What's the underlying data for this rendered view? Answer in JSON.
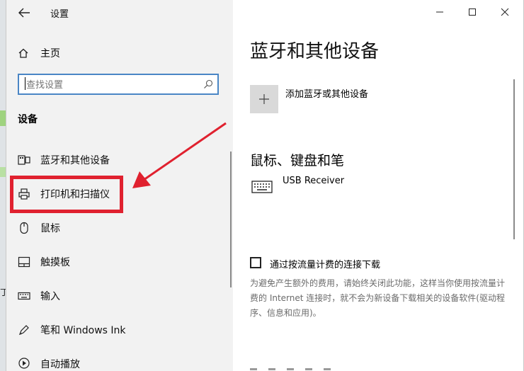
{
  "window": {
    "title": "设置"
  },
  "sidebar": {
    "home_label": "主页",
    "search_placeholder": "查找设置",
    "section_title": "设备",
    "items": [
      {
        "label": "蓝牙和其他设备",
        "icon": "bluetooth-devices-icon"
      },
      {
        "label": "打印机和扫描仪",
        "icon": "printer-icon"
      },
      {
        "label": "鼠标",
        "icon": "mouse-icon"
      },
      {
        "label": "触摸板",
        "icon": "touchpad-icon"
      },
      {
        "label": "输入",
        "icon": "keyboard-icon"
      },
      {
        "label": "笔和 Windows Ink",
        "icon": "pen-icon"
      },
      {
        "label": "自动播放",
        "icon": "autoplay-icon"
      }
    ]
  },
  "content": {
    "page_title": "蓝牙和其他设备",
    "add_device_label": "添加蓝牙或其他设备",
    "section_title": "鼠标、键盘和笔",
    "devices": [
      {
        "name": "USB Receiver",
        "icon": "keyboard-icon"
      }
    ],
    "metered_label": "通过按流量计费的连接下载",
    "metered_desc": "为避免产生额外的费用，请始终关闭此功能，这样当你使用按流量计费的 Internet 连接时，就不会为新设备下载相关的设备软件(驱动程序、信息和应用)。",
    "metered_checked": false
  },
  "annotation": {
    "highlight_color": "#e0212f",
    "highlighted_item": "打印机和扫描仪"
  },
  "colors": {
    "accent": "#4a86c5",
    "sidebar_bg": "#f2f2f2"
  },
  "background": {
    "edge_text": "丁"
  }
}
